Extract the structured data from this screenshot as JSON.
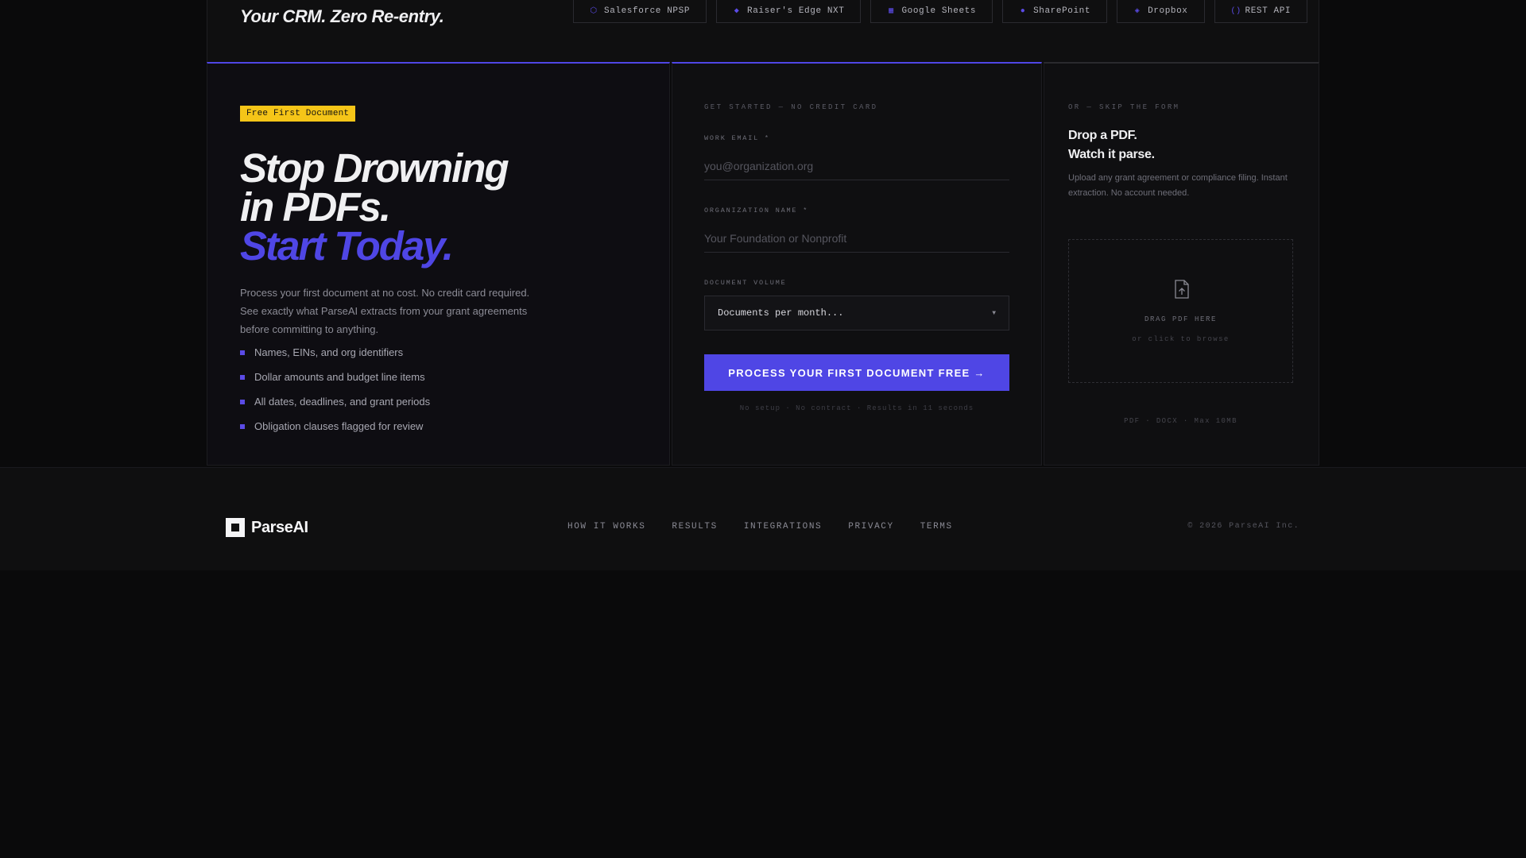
{
  "header": {
    "tagline": "Your CRM. Zero Re-entry.",
    "integrations": [
      {
        "icon": "salesforce-icon",
        "glyph": "⬡",
        "label": "Salesforce NPSP"
      },
      {
        "icon": "raisers-edge-icon",
        "glyph": "◆",
        "label": "Raiser's Edge NXT"
      },
      {
        "icon": "sheets-icon",
        "glyph": "▦",
        "label": "Google Sheets"
      },
      {
        "icon": "sharepoint-icon",
        "glyph": "●",
        "label": "SharePoint"
      },
      {
        "icon": "dropbox-icon",
        "glyph": "◈",
        "label": "Dropbox"
      },
      {
        "icon": "api-icon",
        "glyph": "()",
        "label": "REST API"
      }
    ]
  },
  "hero": {
    "badge": "Free First Document",
    "line1": "Stop Drowning",
    "line2": "in PDFs.",
    "line3": "Start Today.",
    "description": "Process your first document at no cost. No credit card required. See exactly what ParseAI extracts from your grant agreements before committing to anything.",
    "bullets": [
      "Names, EINs, and org identifiers",
      "Dollar amounts and budget line items",
      "All dates, deadlines, and grant periods",
      "Obligation clauses flagged for review"
    ]
  },
  "form": {
    "eyebrow": "Get started — no credit card",
    "email_label": "Work Email *",
    "email_placeholder": "you@organization.org",
    "org_label": "Organization Name *",
    "org_placeholder": "Your Foundation or Nonprofit",
    "volume_label": "Document Volume",
    "volume_value": "Documents per month...",
    "submit_label": "PROCESS YOUR FIRST DOCUMENT FREE →",
    "fine_print": "No setup · No contract · Results in 11 seconds"
  },
  "upload": {
    "eyebrow": "Or — skip the form",
    "title_line1": "Drop a PDF.",
    "title_line2": "Watch it parse.",
    "description": "Upload any grant agreement or compliance filing. Instant extraction. No account needed.",
    "drop_label": "Drag PDF here",
    "drop_sub": "or click to browse",
    "formats": "PDF · DOCX · Max 10MB"
  },
  "footer": {
    "brand": "ParseAI",
    "nav": [
      "HOW IT WORKS",
      "RESULTS",
      "INTEGRATIONS",
      "PRIVACY",
      "TERMS"
    ],
    "copyright": "© 2026 ParseAI Inc."
  },
  "colors": {
    "accent": "#4f46e5",
    "badge": "#f5c518",
    "background": "#0a0a0b"
  }
}
